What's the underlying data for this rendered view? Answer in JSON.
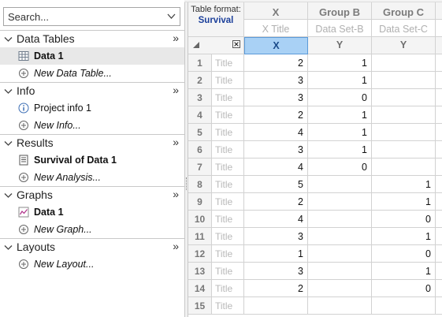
{
  "search": {
    "placeholder": "Search..."
  },
  "navigator": {
    "more_glyph": "»",
    "sections": [
      {
        "title": "Data Tables",
        "items": [
          {
            "label": "Data 1",
            "icon": "data-table-icon",
            "style": "bold",
            "selected": true
          },
          {
            "label": "New Data Table...",
            "icon": "add-circle-icon",
            "style": "italic"
          }
        ]
      },
      {
        "title": "Info",
        "items": [
          {
            "label": "Project info 1",
            "icon": "info-icon",
            "style": "normal"
          },
          {
            "label": "New Info...",
            "icon": "add-circle-icon",
            "style": "italic"
          }
        ]
      },
      {
        "title": "Results",
        "items": [
          {
            "label": "Survival of Data 1",
            "icon": "results-sheet-icon",
            "style": "bold"
          },
          {
            "label": "New Analysis...",
            "icon": "add-circle-icon",
            "style": "italic"
          }
        ]
      },
      {
        "title": "Graphs",
        "items": [
          {
            "label": "Data 1",
            "icon": "graph-icon",
            "style": "bold"
          },
          {
            "label": "New Graph...",
            "icon": "add-circle-icon",
            "style": "italic"
          }
        ]
      },
      {
        "title": "Layouts",
        "items": [
          {
            "label": "New Layout...",
            "icon": "add-circle-icon",
            "style": "italic"
          }
        ]
      }
    ]
  },
  "sheet": {
    "table_format_label": "Table format:",
    "table_format_value": "Survival",
    "columns": [
      {
        "name": "X",
        "title": "X Title",
        "sub": "X"
      },
      {
        "name": "Group B",
        "title": "Data Set-B",
        "sub": "Y"
      },
      {
        "name": "Group C",
        "title": "Data Set-C",
        "sub": "Y"
      }
    ],
    "row_title_placeholder": "Title",
    "rows": [
      {
        "num": "1",
        "x": "2",
        "b": "1",
        "c": ""
      },
      {
        "num": "2",
        "x": "3",
        "b": "1",
        "c": ""
      },
      {
        "num": "3",
        "x": "3",
        "b": "0",
        "c": ""
      },
      {
        "num": "4",
        "x": "2",
        "b": "1",
        "c": ""
      },
      {
        "num": "5",
        "x": "4",
        "b": "1",
        "c": ""
      },
      {
        "num": "6",
        "x": "3",
        "b": "1",
        "c": ""
      },
      {
        "num": "7",
        "x": "4",
        "b": "0",
        "c": ""
      },
      {
        "num": "8",
        "x": "5",
        "b": "",
        "c": "1"
      },
      {
        "num": "9",
        "x": "2",
        "b": "",
        "c": "1"
      },
      {
        "num": "10",
        "x": "4",
        "b": "",
        "c": "0"
      },
      {
        "num": "11",
        "x": "3",
        "b": "",
        "c": "1"
      },
      {
        "num": "12",
        "x": "1",
        "b": "",
        "c": "0"
      },
      {
        "num": "13",
        "x": "3",
        "b": "",
        "c": "1"
      },
      {
        "num": "14",
        "x": "2",
        "b": "",
        "c": "0"
      },
      {
        "num": "15",
        "x": "",
        "b": "",
        "c": ""
      }
    ]
  }
}
